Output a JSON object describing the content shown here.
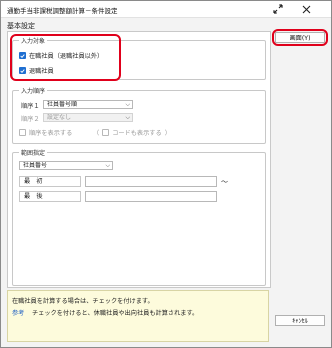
{
  "window": {
    "title": "通勤手当非課税調整額計算－条件設定"
  },
  "section_label": "基本設定",
  "target_group": {
    "title": "入力対象",
    "options": [
      {
        "label": "在職社員（退職社員以外）",
        "checked": true
      },
      {
        "label": "退職社員",
        "checked": true
      }
    ]
  },
  "order_group": {
    "title": "入力順序",
    "order1_label": "順序１",
    "order1_value": "社員番号順",
    "order2_label": "順序２",
    "order2_value": "設定なし",
    "show_order_label": "順序を表示する",
    "show_order_checked": false,
    "show_code_paren_open": "（",
    "show_code_label": "コードも表示する",
    "show_code_checked": false,
    "show_code_paren_close": "）"
  },
  "range_group": {
    "title": "範囲指定",
    "field_value": "社員番号",
    "first_label": "最　初",
    "last_label": "最　後",
    "tilde": "～"
  },
  "buttons": {
    "screen": "画面(Y)",
    "cancel": "ｷｬﾝｾﾙ"
  },
  "help": {
    "line1": "在職社員を計算する場合は、チェックを付けます。",
    "tag": "参考",
    "line2": "チェックを付けると、休職社員や出向社員も計算されます。"
  },
  "colors": {
    "accent": "#1f6fd1",
    "highlight": "#e0001b",
    "help_bg": "#fdfbdc"
  }
}
